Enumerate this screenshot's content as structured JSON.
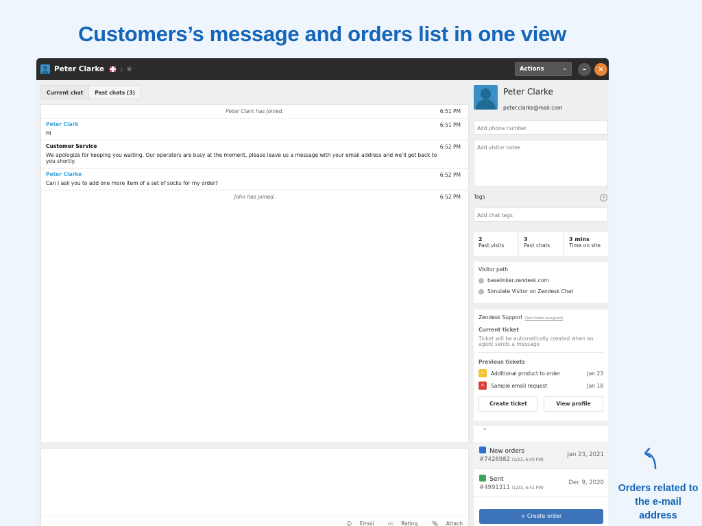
{
  "headline": "Customers’s message and orders list in one view",
  "window": {
    "title": "Peter Clarke",
    "actions_label": "Actions",
    "minimize_icon": "–",
    "close_icon": "×"
  },
  "tabs": [
    {
      "label": "Current chat",
      "active": true
    },
    {
      "label": "Past chats (3)",
      "active": false
    }
  ],
  "messages": [
    {
      "type": "system",
      "text": "Peter Clark has joined.",
      "time": "6:51 PM"
    },
    {
      "type": "visitor",
      "sender": "Peter Clark",
      "text": "Hi",
      "time": "6:51 PM"
    },
    {
      "type": "agent",
      "sender": "Customer Service",
      "text": "We apologize for keeping you waiting. Our operators are busy at the moment, please leave us a message with your email address and we'll get back to you shortly.",
      "time": "6:52 PM"
    },
    {
      "type": "visitor",
      "sender": "Peter Clarke",
      "text": "Can I ask you to add one more item of a set of socks for my order?",
      "time": "6:52 PM"
    },
    {
      "type": "system",
      "text": "John has joined.",
      "time": "6:52 PM"
    }
  ],
  "compose": {
    "emoji_label": "Emoji",
    "rating_label": "Rating",
    "attach_label": "Attach"
  },
  "visitor": {
    "name": "Peter Clarke",
    "email": "peter.clarke@mail.com",
    "phone_placeholder": "Add phone number",
    "notes_placeholder": "Add visitor notes",
    "tags_label": "Tags",
    "tags_placeholder": "Add chat tags",
    "stats": [
      {
        "value": "2",
        "label": "Past visits"
      },
      {
        "value": "3",
        "label": "Past chats"
      },
      {
        "value": "3 mins",
        "label": "Time on site"
      }
    ],
    "path_title": "Visitor path",
    "path": [
      "baselinker.zendesk.com",
      "Simulate Visitor on Zendesk Chat"
    ]
  },
  "zendesk": {
    "title": "Zendesk Support",
    "assignee_link": "(Set ticket assignee)",
    "current_ticket_label": "Current ticket",
    "current_ticket_text": "Ticket will be automatically created when an agent sends a message",
    "previous_tickets_label": "Previous tickets",
    "tickets": [
      {
        "badge": "n",
        "color": "#f2c431",
        "title": "Additional product to order",
        "date": "Jan 23"
      },
      {
        "badge": "o",
        "color": "#d9403a",
        "title": "Sample email request",
        "date": "Jan 18"
      }
    ],
    "create_ticket_label": "Create ticket",
    "view_profile_label": "View profile"
  },
  "orders": {
    "items": [
      {
        "status": "New orders",
        "color": "#2f6fd0",
        "number": "#7426982",
        "meta": "(1/23, 6:40 PM)",
        "date": "Jan 23, 2021"
      },
      {
        "status": "Sent",
        "color": "#3fa35b",
        "number": "#4991311",
        "meta": "(1/23, 6:41 PM)",
        "date": "Dec 9, 2020"
      }
    ],
    "create_label": "+ Create order"
  },
  "annotation": "Orders related to the e-mail address"
}
